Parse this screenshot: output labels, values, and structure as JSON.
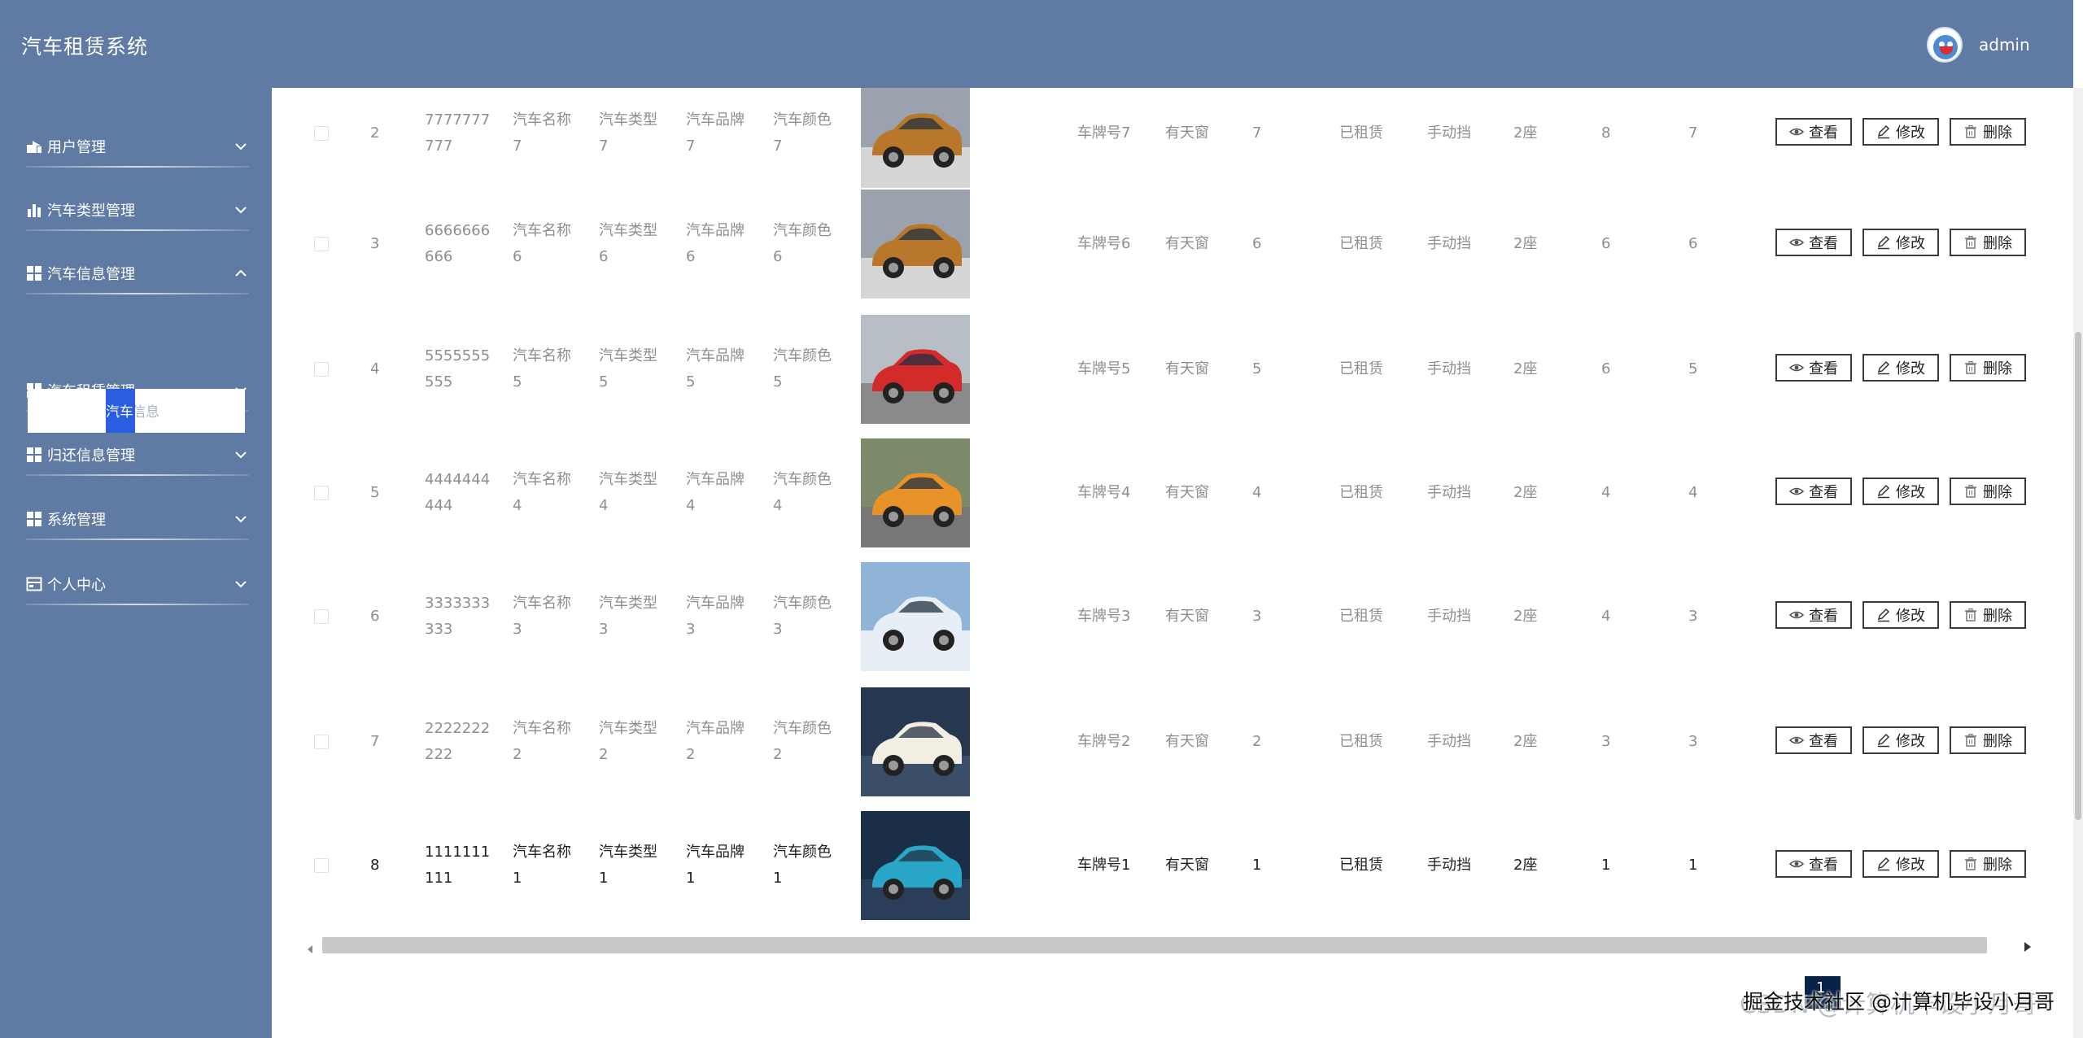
{
  "header": {
    "app_title": "汽车租赁系统",
    "username": "admin"
  },
  "sidebar": {
    "items": [
      {
        "label": "用户管理",
        "icon": "user-icon",
        "expanded": false
      },
      {
        "label": "汽车类型管理",
        "icon": "bar-chart-icon",
        "expanded": false
      },
      {
        "label": "汽车信息管理",
        "icon": "grid-icon",
        "expanded": true
      },
      {
        "label": "汽车租赁管理",
        "icon": "grid-icon",
        "expanded": false
      },
      {
        "label": "归还信息管理",
        "icon": "grid-icon",
        "expanded": false
      },
      {
        "label": "系统管理",
        "icon": "grid-icon",
        "expanded": false
      },
      {
        "label": "个人中心",
        "icon": "card-icon",
        "expanded": false
      }
    ],
    "submenu": {
      "hl": "汽车",
      "rest": "信息",
      "full": "汽车信息"
    }
  },
  "table": {
    "rows": [
      {
        "index": "2",
        "code1": "7777777",
        "code2": "777",
        "name1": "汽车名称",
        "name2": "7",
        "type1": "汽车类型",
        "type2": "7",
        "brand1": "汽车品牌",
        "brand2": "7",
        "color1": "汽车颜色",
        "color2": "7",
        "plate": "车牌号7",
        "sunroof": "有天窗",
        "c1": "7",
        "status": "已租赁",
        "gear": "手动挡",
        "seats": "2座",
        "c2": "8",
        "c3": "7",
        "car_color": "#b8772a"
      },
      {
        "index": "3",
        "code1": "6666666",
        "code2": "666",
        "name1": "汽车名称",
        "name2": "6",
        "type1": "汽车类型",
        "type2": "6",
        "brand1": "汽车品牌",
        "brand2": "6",
        "color1": "汽车颜色",
        "color2": "6",
        "plate": "车牌号6",
        "sunroof": "有天窗",
        "c1": "6",
        "status": "已租赁",
        "gear": "手动挡",
        "seats": "2座",
        "c2": "6",
        "c3": "6",
        "car_color": "#b8772a"
      },
      {
        "index": "4",
        "code1": "5555555",
        "code2": "555",
        "name1": "汽车名称",
        "name2": "5",
        "type1": "汽车类型",
        "type2": "5",
        "brand1": "汽车品牌",
        "brand2": "5",
        "color1": "汽车颜色",
        "color2": "5",
        "plate": "车牌号5",
        "sunroof": "有天窗",
        "c1": "5",
        "status": "已租赁",
        "gear": "手动挡",
        "seats": "2座",
        "c2": "6",
        "c3": "5",
        "car_color": "#d32a2a"
      },
      {
        "index": "5",
        "code1": "4444444",
        "code2": "444",
        "name1": "汽车名称",
        "name2": "4",
        "type1": "汽车类型",
        "type2": "4",
        "brand1": "汽车品牌",
        "brand2": "4",
        "color1": "汽车颜色",
        "color2": "4",
        "plate": "车牌号4",
        "sunroof": "有天窗",
        "c1": "4",
        "status": "已租赁",
        "gear": "手动挡",
        "seats": "2座",
        "c2": "4",
        "c3": "4",
        "car_color": "#e8922a"
      },
      {
        "index": "6",
        "code1": "3333333",
        "code2": "333",
        "name1": "汽车名称",
        "name2": "3",
        "type1": "汽车类型",
        "type2": "3",
        "brand1": "汽车品牌",
        "brand2": "3",
        "color1": "汽车颜色",
        "color2": "3",
        "plate": "车牌号3",
        "sunroof": "有天窗",
        "c1": "3",
        "status": "已租赁",
        "gear": "手动挡",
        "seats": "2座",
        "c2": "4",
        "c3": "3",
        "car_color": "#e8eef5"
      },
      {
        "index": "7",
        "code1": "2222222",
        "code2": "222",
        "name1": "汽车名称",
        "name2": "2",
        "type1": "汽车类型",
        "type2": "2",
        "brand1": "汽车品牌",
        "brand2": "2",
        "color1": "汽车颜色",
        "color2": "2",
        "plate": "车牌号2",
        "sunroof": "有天窗",
        "c1": "2",
        "status": "已租赁",
        "gear": "手动挡",
        "seats": "2座",
        "c2": "3",
        "c3": "3",
        "car_color": "#f2eee2"
      },
      {
        "index": "8",
        "code1": "1111111",
        "code2": "111",
        "name1": "汽车名称",
        "name2": "1",
        "type1": "汽车类型",
        "type2": "1",
        "brand1": "汽车品牌",
        "brand2": "1",
        "color1": "汽车颜色",
        "color2": "1",
        "plate": "车牌号1",
        "sunroof": "有天窗",
        "c1": "1",
        "status": "已租赁",
        "gear": "手动挡",
        "seats": "2座",
        "c2": "1",
        "c3": "1",
        "car_color": "#2aa6c8"
      }
    ],
    "actions": {
      "view": "查看",
      "edit": "修改",
      "delete": "删除"
    }
  },
  "pagination": {
    "current_page": "1"
  },
  "watermark": {
    "csdn": "CSDN @计算机毕设小月哥",
    "juejin": "掘金技术社区 @计算机毕设小月哥"
  },
  "theme": {
    "primary": "#5f7aa3",
    "highlight": "#2a5de0"
  }
}
